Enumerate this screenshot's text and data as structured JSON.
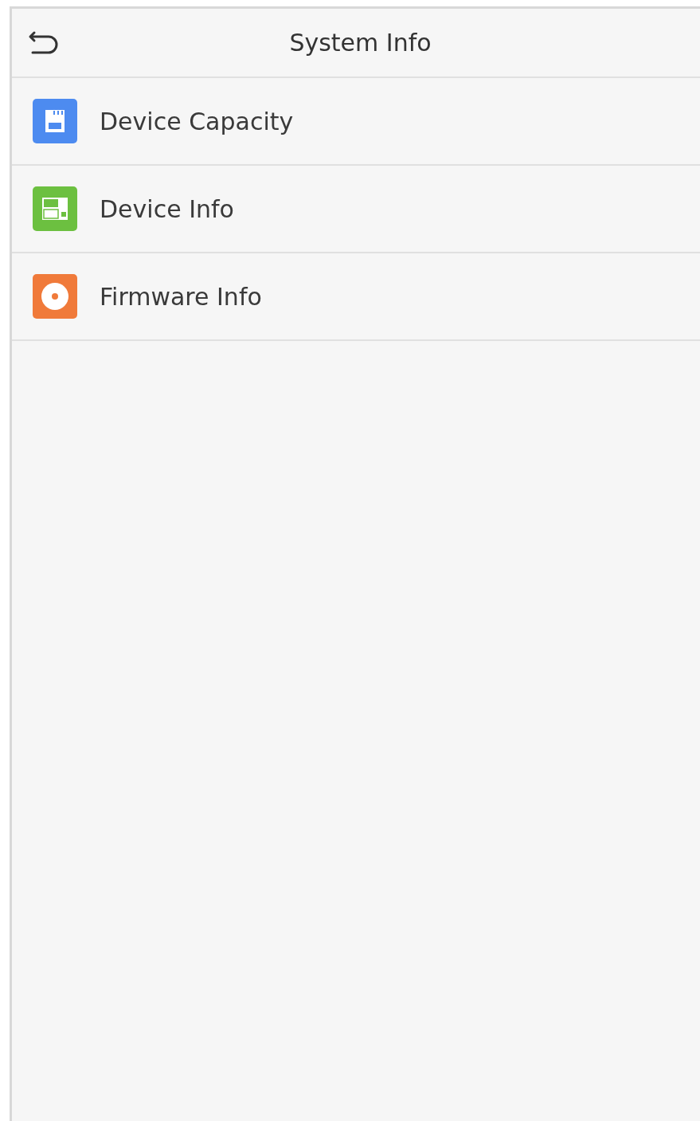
{
  "header": {
    "title": "System Info"
  },
  "menu_items": [
    {
      "label": "Device Capacity",
      "kind": "storage",
      "color": "#4d8bf0"
    },
    {
      "label": "Device Info",
      "kind": "device",
      "color": "#6cc040"
    },
    {
      "label": "Firmware Info",
      "kind": "disc",
      "color": "#f07a3a"
    }
  ]
}
